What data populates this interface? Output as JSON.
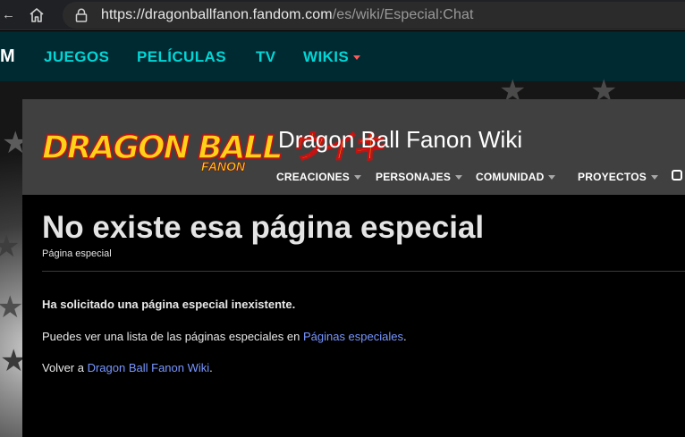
{
  "browser": {
    "back_glyph": "←",
    "home_icon": "home-icon",
    "lock_icon": "lock-icon",
    "url_main": "https://dragonballfanon.fandom.com",
    "url_path": "/es/wiki/Especial:Chat"
  },
  "global_nav": {
    "brand_fragment": "M",
    "items": [
      {
        "label": "JUEGOS"
      },
      {
        "label": "PELÍCULAS"
      },
      {
        "label": "TV"
      },
      {
        "label": "WIKIS"
      }
    ],
    "accent": "#00d6d6",
    "caret_color": "#fd5a5a",
    "background": "#002a32"
  },
  "wiki": {
    "logo_main": "DRAGON BALL ウイキ",
    "logo_sub": "FANON",
    "title": "Dragon Ball Fanon Wiki",
    "nav": [
      {
        "label": "CREACIONES"
      },
      {
        "label": "PERSONAJES"
      },
      {
        "label": "COMUNIDAD"
      },
      {
        "label": "PROYECTOS"
      }
    ]
  },
  "content": {
    "page_title": "No existe esa página especial",
    "page_subtitle": "Página especial",
    "error_text": "Ha solicitado una página especial inexistente.",
    "list_prefix": "Puedes ver una lista de las páginas especiales en ",
    "list_link": "Páginas especiales",
    "list_suffix": ".",
    "back_prefix": "Volver a ",
    "back_link": "Dragon Ball Fanon Wiki",
    "back_suffix": ".",
    "link_color": "#7896ff"
  }
}
